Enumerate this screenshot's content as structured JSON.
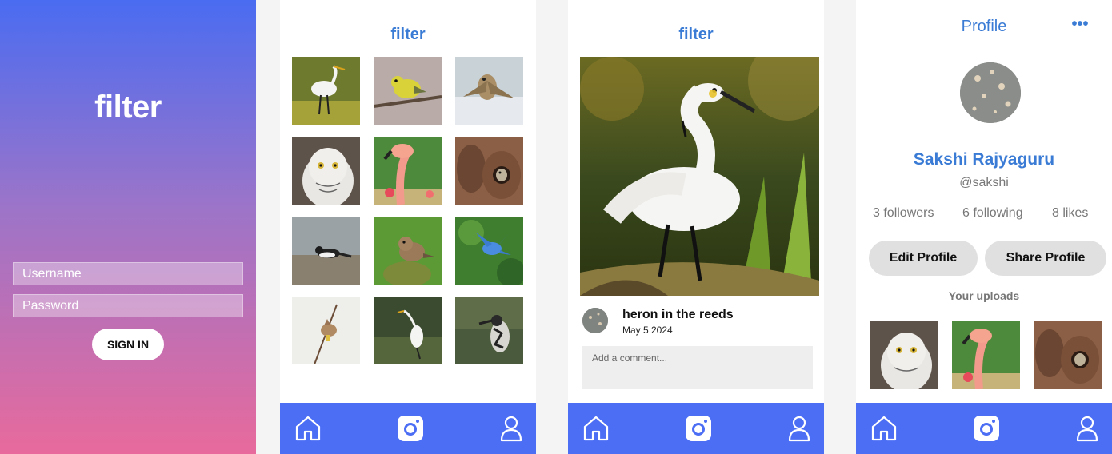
{
  "login": {
    "logo": "filter",
    "username_placeholder": "Username",
    "password_placeholder": "Password",
    "sign_in_label": "SIGN IN"
  },
  "feed": {
    "brand": "filter",
    "photos": [
      {
        "name": "egret-photo"
      },
      {
        "name": "yellow-warbler-photo"
      },
      {
        "name": "owl-flying-photo"
      },
      {
        "name": "snowy-owl-photo"
      },
      {
        "name": "flamingo-photo"
      },
      {
        "name": "bird-in-nest-photo"
      },
      {
        "name": "wagtail-photo"
      },
      {
        "name": "sparrow-photo"
      },
      {
        "name": "bluebird-photo"
      },
      {
        "name": "waxwing-photo"
      },
      {
        "name": "egret-water-photo"
      },
      {
        "name": "kingfisher-photo"
      }
    ]
  },
  "post": {
    "brand": "filter",
    "title": "heron in the reeds",
    "date": "May 5 2024",
    "comment_placeholder": "Add a comment..."
  },
  "profile": {
    "title": "Profile",
    "menu_glyph": "•••",
    "name": "Sakshi Rajyaguru",
    "handle": "@sakshi",
    "followers": "3 followers",
    "following": "6 following",
    "likes": "8 likes",
    "edit_label": "Edit Profile",
    "share_label": "Share Profile",
    "uploads_label": "Your uploads"
  },
  "colors": {
    "accent": "#3a7bd5",
    "navbar": "#4c6ef5",
    "gradient_top": "#4a6cf1",
    "gradient_bottom": "#e86a9c"
  },
  "icons": [
    "home-icon",
    "camera-icon",
    "user-icon",
    "more-options-icon"
  ]
}
